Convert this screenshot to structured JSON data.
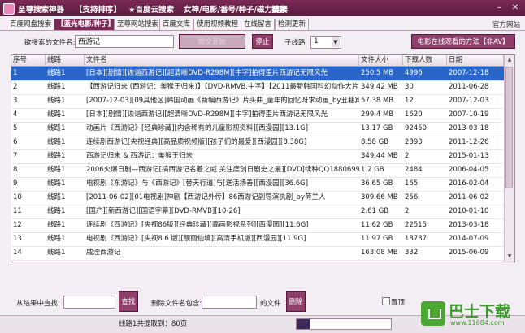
{
  "titlebar": {
    "app_name": "至尊搜索神器",
    "menu": [
      "【支持排序】",
      "★百度云搜索",
      "女神/电影/番号/种子/磁力链接",
      "搜索"
    ]
  },
  "tabs": [
    "百度网盘搜索",
    "【蓝光电影/种子】",
    "至尊网站搜索",
    "百度文库",
    "使用视频教程",
    "在线留言",
    "检测更新"
  ],
  "official_site": "官方网站",
  "search": {
    "label": "欲搜索的文件名:",
    "value": "西游记",
    "start_btn": "提交开始",
    "stop_btn": "停止",
    "route_label": "子线路",
    "route_value": "1",
    "watch_btn": "电影在线观看的方法【非AV】"
  },
  "table": {
    "columns": [
      "序号",
      "线路",
      "文件名",
      "文件大小",
      "下载人数",
      "日期"
    ],
    "rows": [
      [
        "1",
        "线路1",
        "[日本][剧情][诙谐西游记][超清晰DVD-R298M][中字]拍得歪片西游记无限风光",
        "250.5 MB",
        "4996",
        "2007-12-18"
      ],
      [
        "2",
        "线路1",
        "【西游记归来 (西游记：美猴王归来)】【DVD-RMVB.中字】【2011最新韩国科幻动作大片】",
        "349.42 MB",
        "30",
        "2011-06-28"
      ],
      [
        "3",
        "线路1",
        "[2007-12-03][09其他区]韩国动画《新编西游记》片头曲_童年的回忆呀求动画_by丑巷宾西",
        "57.38 MB",
        "12",
        "2007-12-03"
      ],
      [
        "4",
        "线路1",
        "[日本][剧情][诙谐西游记][超清晰DVD-R298M][中字]拍得歪片西游记无限风光",
        "299.4 MB",
        "1620",
        "2007-10-19"
      ],
      [
        "5",
        "线路1",
        "动画片《西游记》[经典珍藏][内含稀有的儿童影视资料][西漫园][13.1G]",
        "13.17 GB",
        "92450",
        "2013-03-18"
      ],
      [
        "6",
        "线路1",
        "连续剧西游记[央视经典][高品质视频版][孩子们的最爱][西漫园][8.38G]",
        "8.58 GB",
        "2893",
        "2011-12-26"
      ],
      [
        "7",
        "线路1",
        "西游记归来 & 西游记：美猴王归来",
        "349.44 MB",
        "2",
        "2015-01-13"
      ],
      [
        "8",
        "线路1",
        "2006火爆日剧—西游记[搞西游记名着之威 关注度创日剧史之最][DVD]续种QQ1880699",
        "1.2 GB",
        "2484",
        "2006-04-05"
      ],
      [
        "9",
        "线路1",
        "电视剧《东游记》与《西游记》[替天行道]与[送活扬善][西漫园][36.6G]",
        "36.65 GB",
        "165",
        "2016-02-04"
      ],
      [
        "10",
        "线路1",
        "[2011-06-02][01电视剧]神剧【西游记外传】86西游记副导演执剧_by荷兰人",
        "309.66 MB",
        "256",
        "2011-06-02"
      ],
      [
        "11",
        "线路1",
        "[国产][新西游记][国语字幕][DVD-RMVB][10-26]",
        "2.61 GB",
        "2",
        "2010-01-10"
      ],
      [
        "12",
        "线路1",
        "连续剧《西游记》[央视86版][经典珍藏][高画影视系列][西漫园][11.6G]",
        "11.62 GB",
        "22515",
        "2013-03-18"
      ],
      [
        "13",
        "线路1",
        "电视剧《西游记》[央视8 6 版][靓丽仙境][高清手机版][西漫园][11.9G]",
        "11.97 GB",
        "18787",
        "2014-07-09"
      ],
      [
        "14",
        "线路1",
        "戚湮西游记",
        "163.08 MB",
        "332",
        "2015-06-09"
      ]
    ]
  },
  "filter": {
    "find_label": "从结果中查找:",
    "find_value": "",
    "find_btn": "查找",
    "delete_label": "删除文件名包含:",
    "delete_value": "",
    "delete_suffix": "的文件",
    "delete_btn": "删除",
    "top_label": "置顶"
  },
  "status": {
    "summary": "线路1共提取到：80页"
  },
  "progress_fraction": 0.14,
  "watermark": {
    "big": "巴士下载",
    "small": "www.11684.com"
  }
}
